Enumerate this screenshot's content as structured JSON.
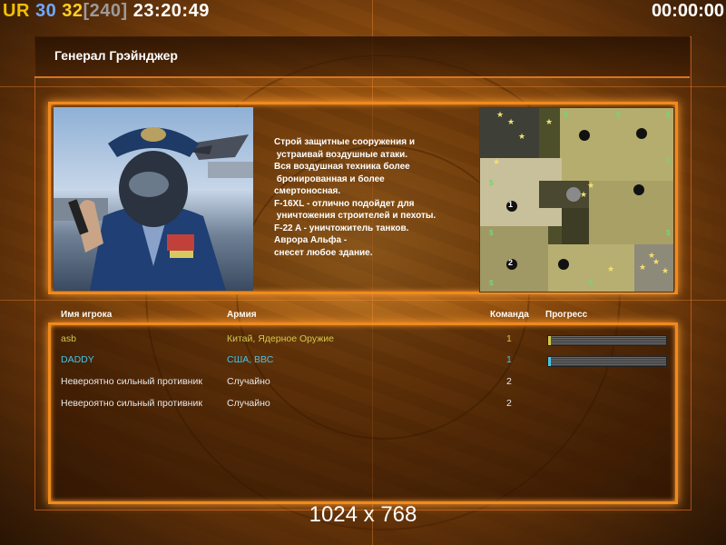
{
  "hud": {
    "ur": "UR",
    "fps": "30",
    "count": "32",
    "bracket": "[240]",
    "clock": "23:20:49",
    "timer": "00:00:00"
  },
  "general": {
    "title": "Генерал Грэйнджер",
    "briefing": "Строй защитные сооружения и\n устраивай воздушные атаки.\nВся воздушная техника более\n бронированная и более\nсмертоносная.\nF-16XL - отлично подойдет для\n уничтожения строителей и пехоты.\nF-22 A - уничтожитель танков.\nАврора Альфа -\nснесет любое здание."
  },
  "columns": {
    "player": "Имя игрока",
    "army": "Армия",
    "team": "Команда",
    "progress": "Прогресс"
  },
  "players": [
    {
      "name": "asb",
      "army": "Китай, Ядерное Оружие",
      "team": "1",
      "color": "#d4c84a",
      "progress": 0.02
    },
    {
      "name": "DADDY",
      "army": "США, ВВС",
      "team": "1",
      "color": "#46c4e6",
      "progress": 0.02
    },
    {
      "name": "Невероятно сильный противник",
      "army": "Случайно",
      "team": "2",
      "color": "#e8e8e8"
    },
    {
      "name": "Невероятно сильный противник",
      "army": "Случайно",
      "team": "2",
      "color": "#e8e8e8"
    }
  ],
  "map": {
    "start_labels": [
      "1",
      "2"
    ]
  },
  "resolution": "1024 x 768"
}
